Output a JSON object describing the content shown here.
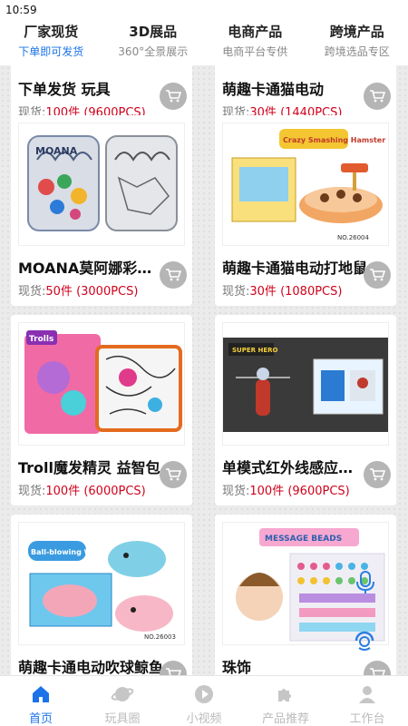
{
  "status": {
    "time": "10:59"
  },
  "tabs": [
    {
      "title": "厂家现货",
      "sub": "下单即可发货"
    },
    {
      "title": "3D展品",
      "sub": "360°全景展示"
    },
    {
      "title": "电商产品",
      "sub": "电商平台专供"
    },
    {
      "title": "跨境产品",
      "sub": "跨境选品专区"
    }
  ],
  "products": [
    {
      "title": "下单发货 玩具",
      "stock_label": "现货:",
      "stock_value": "100件 (9600PCS)"
    },
    {
      "title": "萌趣卡通猫电动",
      "stock_label": "现货:",
      "stock_value": "30件 (1440PCS)"
    },
    {
      "title": "MOANA莫阿娜彩绘背包",
      "stock_label": "现货:",
      "stock_value": "50件 (3000PCS)"
    },
    {
      "title": "萌趣卡通猫电动打地鼠",
      "stock_label": "现货:",
      "stock_value": "30件 (1080PCS)"
    },
    {
      "title": "Troll魔发精灵 益智包",
      "stock_label": "现货:",
      "stock_value": "100件 (6000PCS)"
    },
    {
      "title": "单模式红外线感应飞行器",
      "stock_label": "现货:",
      "stock_value": "100件 (9600PCS)"
    },
    {
      "title": "萌趣卡通电动吹球鲸鱼",
      "stock_label": "",
      "stock_value": ""
    },
    {
      "title": "珠饰",
      "stock_label": "",
      "stock_value": ""
    }
  ],
  "image_labels": {
    "moana": "MOANA",
    "hamster": "Crazy Smashing Hamster",
    "hamster_no": "NO.26004",
    "trolls": "Trolls",
    "hero": "SUPER HERO",
    "whale": "Ball-blowing Whale",
    "whale_no": "NO.26003",
    "beads": "MESSAGE BEADS"
  },
  "nav": [
    {
      "label": "首页",
      "icon": "home-icon"
    },
    {
      "label": "玩具圈",
      "icon": "planet-icon"
    },
    {
      "label": "小视频",
      "icon": "play-icon"
    },
    {
      "label": "产品推荐",
      "icon": "puzzle-icon"
    },
    {
      "label": "工作台",
      "icon": "user-icon"
    }
  ],
  "colors": {
    "accent": "#1a73e8",
    "price": "#d0021b"
  }
}
